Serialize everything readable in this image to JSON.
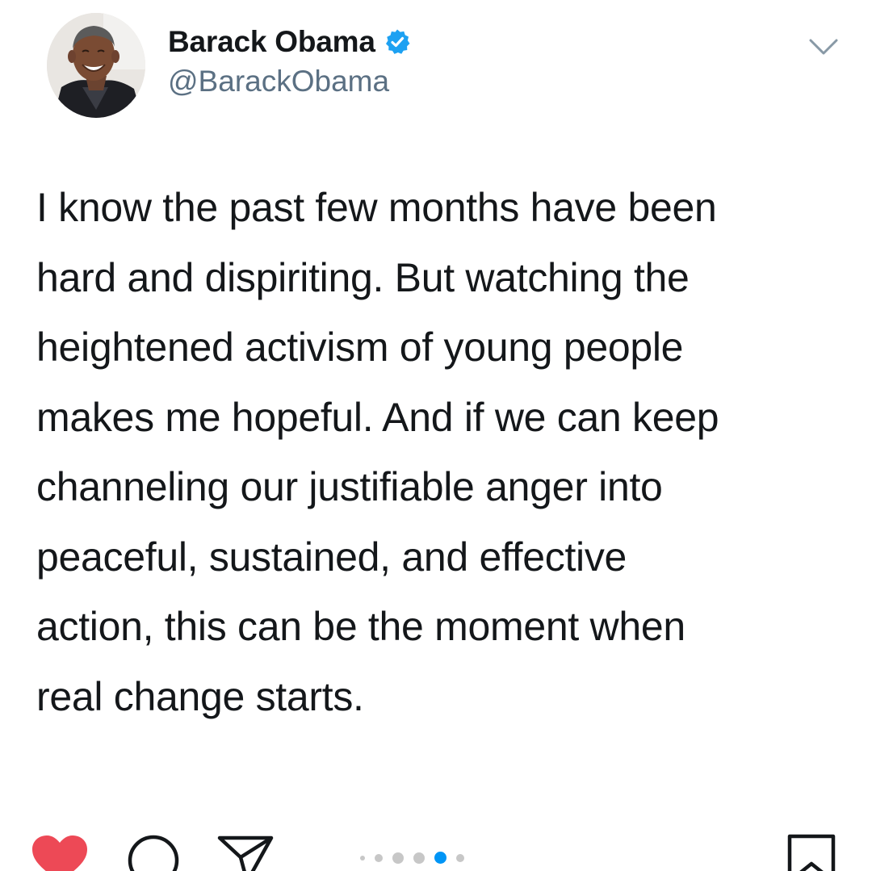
{
  "tweet": {
    "author": {
      "display_name": "Barack Obama",
      "handle": "@BarackObama",
      "verified": true,
      "avatar_icon": "profile-photo"
    },
    "text_lines": [
      "I know the past few months have been",
      "hard and dispiriting. But watching the",
      "heightened activism of young people",
      "makes me hopeful. And if we can keep",
      "channeling our justifiable anger into",
      "peaceful, sustained, and effective",
      "action, this can be the moment when",
      "real change starts."
    ],
    "menu_icon": "chevron-down-icon"
  },
  "post_actions": {
    "like_icon": "heart-icon",
    "comment_icon": "comment-icon",
    "share_icon": "send-icon",
    "save_icon": "bookmark-icon",
    "liked": true
  },
  "carousel": {
    "total_dots": 6,
    "active_index": 4
  },
  "colors": {
    "verified_badge": "#1da1f2",
    "like_active": "#ed4956",
    "carousel_active": "#0095f6",
    "handle_text": "#5b7083"
  }
}
